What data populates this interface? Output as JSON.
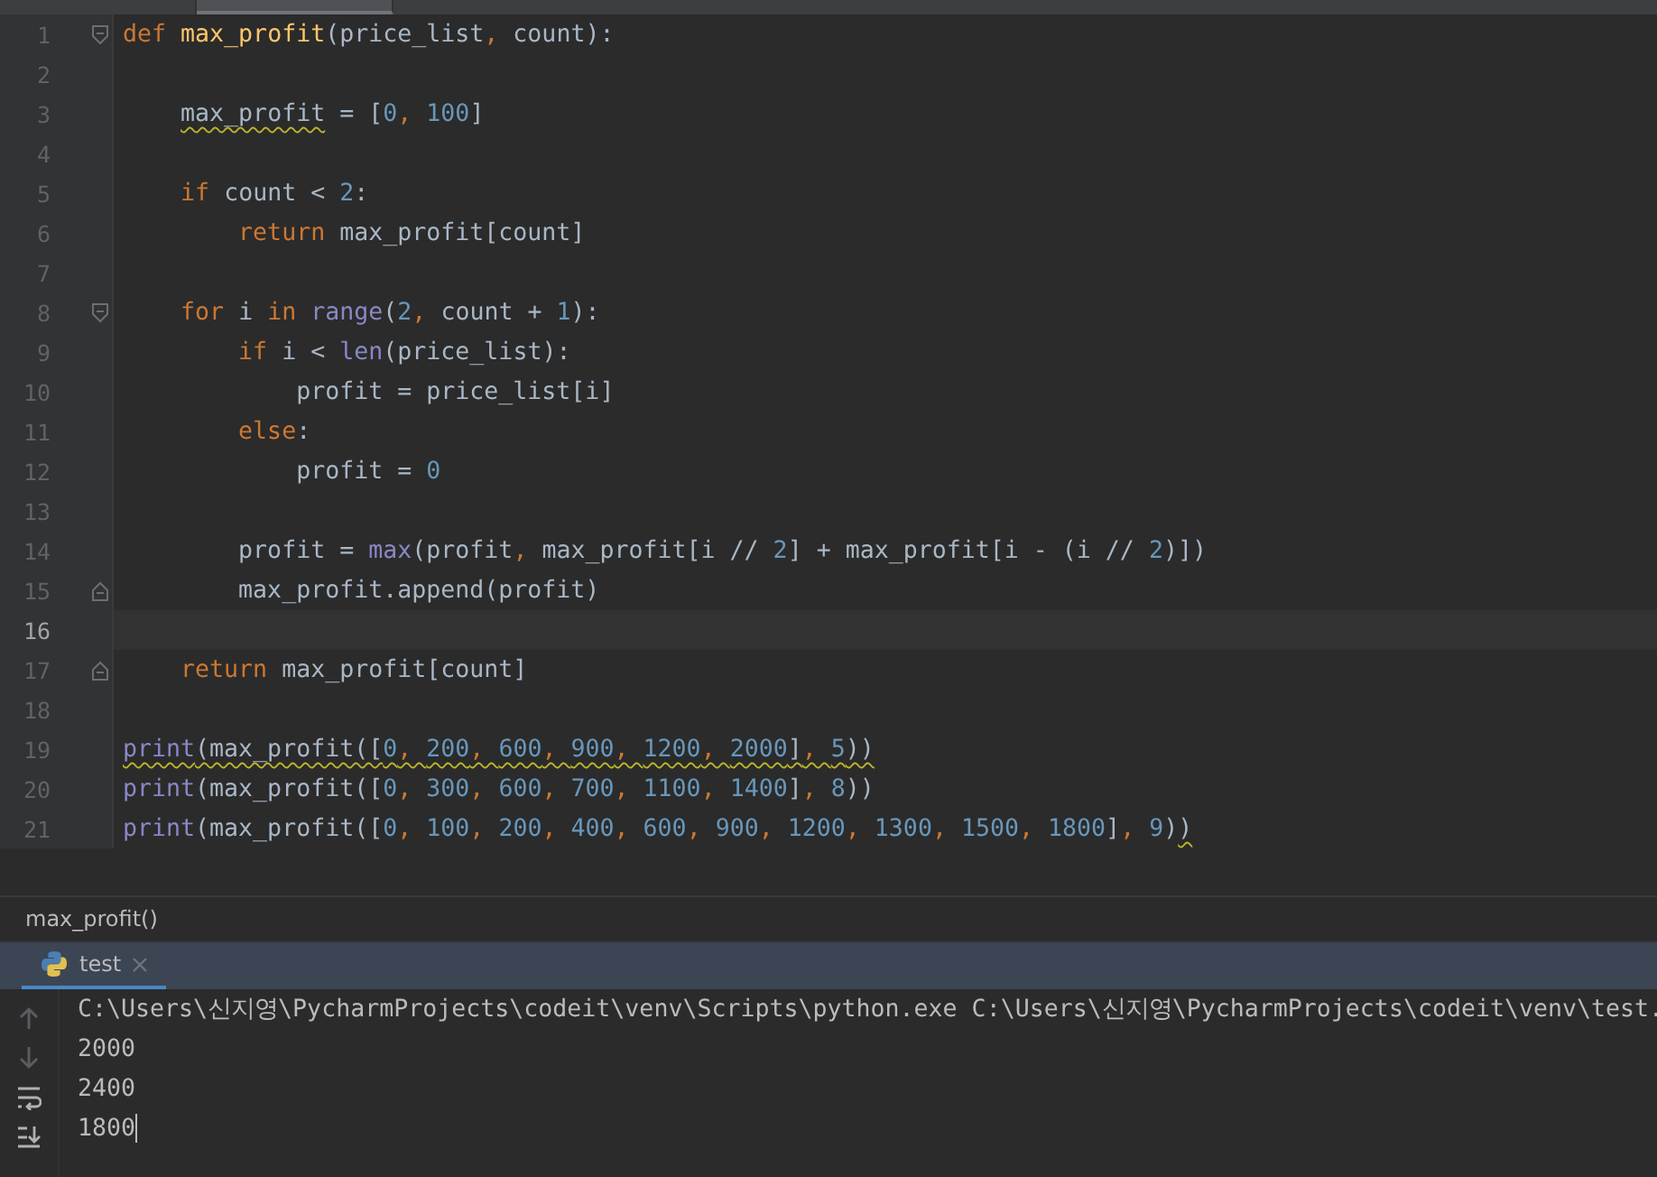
{
  "editor_tabs": [
    {
      "selected": false
    },
    {
      "selected": true
    }
  ],
  "code_lines": [
    {
      "number": "1",
      "fold_start": true,
      "spans": [
        {
          "wavy": false,
          "tokens": [
            {
              "kind": "kw",
              "text": "def "
            },
            {
              "kind": "fn",
              "text": "max_profit"
            },
            {
              "kind": "plain",
              "text": "(price_list"
            },
            {
              "kind": "kw",
              "text": ", "
            },
            {
              "kind": "plain",
              "text": "count):"
            }
          ]
        }
      ]
    },
    {
      "number": "2"
    },
    {
      "number": "3",
      "spans": [
        {
          "wavy": true,
          "tokens": [
            {
              "kind": "plain",
              "text": "    max_profit"
            }
          ]
        },
        {
          "wavy": false,
          "tokens": [
            {
              "kind": "plain",
              "text": " = ["
            },
            {
              "kind": "num",
              "text": "0"
            },
            {
              "kind": "kw",
              "text": ", "
            },
            {
              "kind": "num",
              "text": "100"
            },
            {
              "kind": "plain",
              "text": "]"
            }
          ]
        }
      ]
    },
    {
      "number": "4"
    },
    {
      "number": "5",
      "spans": [
        {
          "wavy": false,
          "tokens": [
            {
              "kind": "kw",
              "text": "    if "
            },
            {
              "kind": "plain",
              "text": "count < "
            },
            {
              "kind": "num",
              "text": "2"
            },
            {
              "kind": "plain",
              "text": ":"
            }
          ]
        }
      ]
    },
    {
      "number": "6",
      "spans": [
        {
          "wavy": false,
          "tokens": [
            {
              "kind": "kw",
              "text": "        return "
            },
            {
              "kind": "plain",
              "text": "max_profit[count]"
            }
          ]
        }
      ]
    },
    {
      "number": "7"
    },
    {
      "number": "8",
      "fold_start": true,
      "spans": [
        {
          "wavy": false,
          "tokens": [
            {
              "kind": "kw",
              "text": "    for "
            },
            {
              "kind": "plain",
              "text": "i "
            },
            {
              "kind": "kw",
              "text": "in "
            },
            {
              "kind": "builtin",
              "text": "range"
            },
            {
              "kind": "plain",
              "text": "("
            },
            {
              "kind": "num",
              "text": "2"
            },
            {
              "kind": "kw",
              "text": ", "
            },
            {
              "kind": "plain",
              "text": "count + "
            },
            {
              "kind": "num",
              "text": "1"
            },
            {
              "kind": "plain",
              "text": "):"
            }
          ]
        }
      ]
    },
    {
      "number": "9",
      "spans": [
        {
          "wavy": false,
          "tokens": [
            {
              "kind": "kw",
              "text": "        if "
            },
            {
              "kind": "plain",
              "text": "i < "
            },
            {
              "kind": "builtin",
              "text": "len"
            },
            {
              "kind": "plain",
              "text": "(price_list):"
            }
          ]
        }
      ]
    },
    {
      "number": "10",
      "spans": [
        {
          "wavy": false,
          "tokens": [
            {
              "kind": "plain",
              "text": "            profit = price_list[i]"
            }
          ]
        }
      ]
    },
    {
      "number": "11",
      "spans": [
        {
          "wavy": false,
          "tokens": [
            {
              "kind": "kw",
              "text": "        else"
            },
            {
              "kind": "plain",
              "text": ":"
            }
          ]
        }
      ]
    },
    {
      "number": "12",
      "spans": [
        {
          "wavy": false,
          "tokens": [
            {
              "kind": "plain",
              "text": "            profit = "
            },
            {
              "kind": "num",
              "text": "0"
            }
          ]
        }
      ]
    },
    {
      "number": "13"
    },
    {
      "number": "14",
      "spans": [
        {
          "wavy": false,
          "tokens": [
            {
              "kind": "plain",
              "text": "        profit = "
            },
            {
              "kind": "builtin",
              "text": "max"
            },
            {
              "kind": "plain",
              "text": "(profit"
            },
            {
              "kind": "kw",
              "text": ", "
            },
            {
              "kind": "plain",
              "text": "max_profit[i // "
            },
            {
              "kind": "num",
              "text": "2"
            },
            {
              "kind": "plain",
              "text": "] + max_profit[i - (i // "
            },
            {
              "kind": "num",
              "text": "2"
            },
            {
              "kind": "plain",
              "text": ")])"
            }
          ]
        }
      ]
    },
    {
      "number": "15",
      "fold_end": true,
      "spans": [
        {
          "wavy": false,
          "tokens": [
            {
              "kind": "plain",
              "text": "        max_profit.append(profit)"
            }
          ]
        }
      ]
    },
    {
      "number": "16",
      "current": true
    },
    {
      "number": "17",
      "fold_end": true,
      "spans": [
        {
          "wavy": false,
          "tokens": [
            {
              "kind": "kw",
              "text": "    return "
            },
            {
              "kind": "plain",
              "text": "max_profit[count]"
            }
          ]
        }
      ]
    },
    {
      "number": "18"
    },
    {
      "number": "19",
      "spans": [
        {
          "wavy": true,
          "tokens": [
            {
              "kind": "builtin",
              "text": "print"
            },
            {
              "kind": "plain",
              "text": "(max_profit(["
            },
            {
              "kind": "num",
              "text": "0"
            },
            {
              "kind": "kw",
              "text": ", "
            },
            {
              "kind": "num",
              "text": "200"
            },
            {
              "kind": "kw",
              "text": ", "
            },
            {
              "kind": "num",
              "text": "600"
            },
            {
              "kind": "kw",
              "text": ", "
            },
            {
              "kind": "num",
              "text": "900"
            },
            {
              "kind": "kw",
              "text": ", "
            },
            {
              "kind": "num",
              "text": "1200"
            },
            {
              "kind": "kw",
              "text": ", "
            },
            {
              "kind": "num",
              "text": "2000"
            },
            {
              "kind": "plain",
              "text": "]"
            },
            {
              "kind": "kw",
              "text": ", "
            },
            {
              "kind": "num",
              "text": "5"
            },
            {
              "kind": "plain",
              "text": "))"
            }
          ]
        }
      ]
    },
    {
      "number": "20",
      "spans": [
        {
          "wavy": false,
          "tokens": [
            {
              "kind": "builtin",
              "text": "print"
            },
            {
              "kind": "plain",
              "text": "(max_profit(["
            },
            {
              "kind": "num",
              "text": "0"
            },
            {
              "kind": "kw",
              "text": ", "
            },
            {
              "kind": "num",
              "text": "300"
            },
            {
              "kind": "kw",
              "text": ", "
            },
            {
              "kind": "num",
              "text": "600"
            },
            {
              "kind": "kw",
              "text": ", "
            },
            {
              "kind": "num",
              "text": "700"
            },
            {
              "kind": "kw",
              "text": ", "
            },
            {
              "kind": "num",
              "text": "1100"
            },
            {
              "kind": "kw",
              "text": ", "
            },
            {
              "kind": "num",
              "text": "1400"
            },
            {
              "kind": "plain",
              "text": "]"
            },
            {
              "kind": "kw",
              "text": ", "
            },
            {
              "kind": "num",
              "text": "8"
            },
            {
              "kind": "plain",
              "text": "))"
            }
          ]
        }
      ]
    },
    {
      "number": "21",
      "spans": [
        {
          "wavy": false,
          "tokens": [
            {
              "kind": "builtin",
              "text": "print"
            },
            {
              "kind": "plain",
              "text": "(max_profit(["
            },
            {
              "kind": "num",
              "text": "0"
            },
            {
              "kind": "kw",
              "text": ", "
            },
            {
              "kind": "num",
              "text": "100"
            },
            {
              "kind": "kw",
              "text": ", "
            },
            {
              "kind": "num",
              "text": "200"
            },
            {
              "kind": "kw",
              "text": ", "
            },
            {
              "kind": "num",
              "text": "400"
            },
            {
              "kind": "kw",
              "text": ", "
            },
            {
              "kind": "num",
              "text": "600"
            },
            {
              "kind": "kw",
              "text": ", "
            },
            {
              "kind": "num",
              "text": "900"
            },
            {
              "kind": "kw",
              "text": ", "
            },
            {
              "kind": "num",
              "text": "1200"
            },
            {
              "kind": "kw",
              "text": ", "
            },
            {
              "kind": "num",
              "text": "1300"
            },
            {
              "kind": "kw",
              "text": ", "
            },
            {
              "kind": "num",
              "text": "1500"
            },
            {
              "kind": "kw",
              "text": ", "
            },
            {
              "kind": "num",
              "text": "1800"
            },
            {
              "kind": "plain",
              "text": "]"
            },
            {
              "kind": "kw",
              "text": ", "
            },
            {
              "kind": "num",
              "text": "9"
            },
            {
              "kind": "plain",
              "text": ")"
            }
          ]
        },
        {
          "wavy": true,
          "tokens": [
            {
              "kind": "plain",
              "text": ")"
            }
          ]
        }
      ]
    }
  ],
  "breadcrumb": "max_profit()",
  "run_tabs": [
    {
      "label": "test",
      "selected": true
    }
  ],
  "console_tools": [
    {
      "kind": "up"
    },
    {
      "kind": "down"
    },
    {
      "kind": "wrap"
    },
    {
      "kind": "scroll-end"
    }
  ],
  "console_lines": [
    "C:\\Users\\신지영\\PycharmProjects\\codeit\\venv\\Scripts\\python.exe C:\\Users\\신지영\\PycharmProjects\\codeit\\venv\\test.",
    "2000",
    "2400",
    "1800"
  ]
}
